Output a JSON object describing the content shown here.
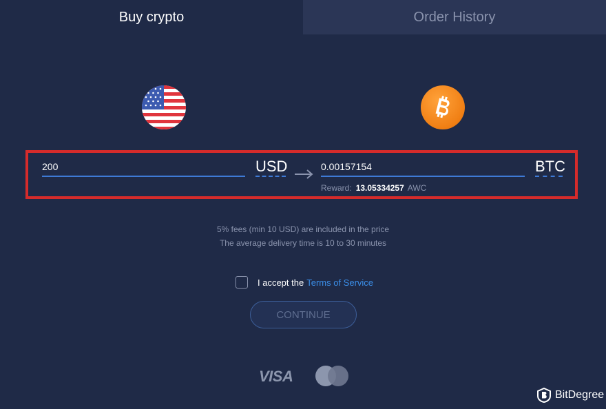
{
  "tabs": {
    "buy": "Buy crypto",
    "history": "Order History"
  },
  "exchange": {
    "send_amount": "200",
    "send_currency": "USD",
    "receive_amount": "0.00157154",
    "receive_currency": "BTC",
    "reward_label": "Reward:",
    "reward_value": "13.05334257",
    "reward_unit": "AWC"
  },
  "info": {
    "fees": "5% fees (min 10 USD) are included in the price",
    "delivery": "The average delivery time is 10 to 30 minutes"
  },
  "terms": {
    "prefix": "I accept the",
    "link": "Terms of Service"
  },
  "continue_label": "CONTINUE",
  "payment": {
    "visa": "VISA"
  },
  "watermark": "BitDegree",
  "colors": {
    "background": "#1f2a47",
    "accent": "#3e7ad6",
    "highlight": "#d52b2b",
    "bitcoin": "#f7931a"
  },
  "icons": [
    "us-flag-icon",
    "bitcoin-icon",
    "arrow-right-icon",
    "visa-logo",
    "mastercard-logo",
    "bitdegree-logo"
  ]
}
